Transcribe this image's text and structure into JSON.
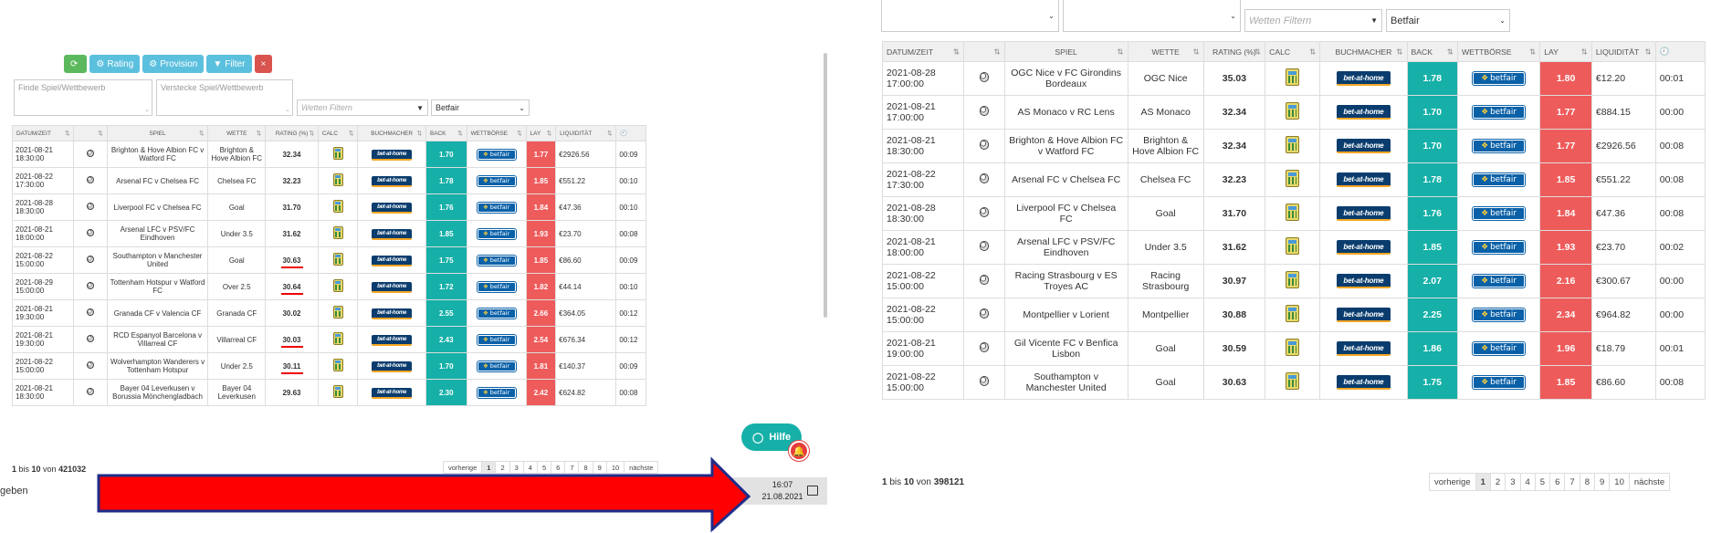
{
  "left": {
    "toolbar": {
      "refresh_label": "",
      "rating_label": "Rating",
      "provision_label": "Provision",
      "filter_label": "Filter",
      "close_label": "×"
    },
    "search_placeholder": "Finde Spiel/Wettbewerb",
    "hide_placeholder": "Verstecke Spiel/Wettbewerb",
    "bet_filter_placeholder": "Wetten Filtern",
    "exchange_value": "Betfair",
    "columns": [
      "DATUM/ZEIT",
      "",
      "SPIEL",
      "WETTE",
      "RATING (%)",
      "CALC",
      "BUCHMACHER",
      "BACK",
      "WETTBÖRSE",
      "LAY",
      "LIQUIDITÄT",
      ""
    ],
    "rows": [
      {
        "date": "2021-08-21",
        "time": "18:30:00",
        "game": "Brighton & Hove Albion FC v Watford FC",
        "bet": "Brighton & Hove Albion FC",
        "rating": "32.34",
        "back": "1.70",
        "lay": "1.77",
        "liq": "€2926.56",
        "t": "00:09"
      },
      {
        "date": "2021-08-22",
        "time": "17:30:00",
        "game": "Arsenal FC v Chelsea FC",
        "bet": "Chelsea FC",
        "rating": "32.23",
        "back": "1.78",
        "lay": "1.85",
        "liq": "€551.22",
        "t": "00:10"
      },
      {
        "date": "2021-08-28",
        "time": "18:30:00",
        "game": "Liverpool FC v Chelsea FC",
        "bet": "Goal",
        "rating": "31.70",
        "back": "1.76",
        "lay": "1.84",
        "liq": "€47.36",
        "t": "00:10"
      },
      {
        "date": "2021-08-21",
        "time": "18:00:00",
        "game": "Arsenal LFC v PSV/FC Eindhoven",
        "bet": "Under 3.5",
        "rating": "31.62",
        "back": "1.85",
        "lay": "1.93",
        "liq": "€23.70",
        "t": "00:08"
      },
      {
        "date": "2021-08-22",
        "time": "15:00:00",
        "game": "Southampton v Manchester United",
        "bet": "Goal",
        "rating": "30.63",
        "back": "1.75",
        "lay": "1.85",
        "liq": "€86.60",
        "t": "00:09"
      },
      {
        "date": "2021-08-29",
        "time": "15:00:00",
        "game": "Tottenham Hotspur v Watford FC",
        "bet": "Over 2.5",
        "rating": "30.64",
        "back": "1.72",
        "lay": "1.82",
        "liq": "€44.14",
        "t": "00:10"
      },
      {
        "date": "2021-08-21",
        "time": "19:30:00",
        "game": "Granada CF v Valencia CF",
        "bet": "Granada CF",
        "rating": "30.02",
        "back": "2.55",
        "lay": "2.66",
        "liq": "€364.05",
        "t": "00:12"
      },
      {
        "date": "2021-08-21",
        "time": "19:30:00",
        "game": "RCD Espanyol Barcelona v Villarreal CF",
        "bet": "Villarreal CF",
        "rating": "30.03",
        "back": "2.43",
        "lay": "2.54",
        "liq": "€676.34",
        "t": "00:12"
      },
      {
        "date": "2021-08-22",
        "time": "15:00:00",
        "game": "Wolverhampton Wanderers v Tottenham Hotspur",
        "bet": "Under 2.5",
        "rating": "30.11",
        "back": "1.70",
        "lay": "1.81",
        "liq": "€140.37",
        "t": "00:09"
      },
      {
        "date": "2021-08-21",
        "time": "18:30:00",
        "game": "Bayer 04 Leverkusen v Borussia Mönchengladbach",
        "bet": "Bayer 04 Leverkusen",
        "rating": "29.63",
        "back": "2.30",
        "lay": "2.42",
        "liq": "€624.82",
        "t": "00:08"
      }
    ],
    "footer": {
      "a": "1",
      "b": " bis ",
      "c": "10",
      "d": " von ",
      "e": "421032"
    },
    "pager": [
      "vorherige",
      "1",
      "2",
      "3",
      "4",
      "5",
      "6",
      "7",
      "8",
      "9",
      "10",
      "nächste"
    ],
    "hilfe_label": "Hilfe",
    "clock_time": "16:07",
    "clock_date": "21.08.2021",
    "geben_text": "geben"
  },
  "right": {
    "bet_filter_placeholder": "Wetten Filtern",
    "exchange_value": "Betfair",
    "columns": [
      "DATUM/ZEIT",
      "",
      "SPIEL",
      "WETTE",
      "RATING (%)",
      "CALC",
      "BUCHMACHER",
      "BACK",
      "WETTBÖRSE",
      "LAY",
      "LIQUIDITÄT",
      ""
    ],
    "rows": [
      {
        "date": "2021-08-28",
        "time": "17:00:00",
        "game": "OGC Nice v FC Girondins Bordeaux",
        "bet": "OGC Nice",
        "rating": "35.03",
        "back": "1.78",
        "lay": "1.80",
        "liq": "€12.20",
        "t": "00:01"
      },
      {
        "date": "2021-08-21",
        "time": "17:00:00",
        "game": "AS Monaco v RC Lens",
        "bet": "AS Monaco",
        "rating": "32.34",
        "back": "1.70",
        "lay": "1.77",
        "liq": "€884.15",
        "t": "00:00"
      },
      {
        "date": "2021-08-21",
        "time": "18:30:00",
        "game": "Brighton & Hove Albion FC v Watford FC",
        "bet": "Brighton & Hove Albion FC",
        "rating": "32.34",
        "back": "1.70",
        "lay": "1.77",
        "liq": "€2926.56",
        "t": "00:08"
      },
      {
        "date": "2021-08-22",
        "time": "17:30:00",
        "game": "Arsenal FC v Chelsea FC",
        "bet": "Chelsea FC",
        "rating": "32.23",
        "back": "1.78",
        "lay": "1.85",
        "liq": "€551.22",
        "t": "00:08"
      },
      {
        "date": "2021-08-28",
        "time": "18:30:00",
        "game": "Liverpool FC v Chelsea FC",
        "bet": "Goal",
        "rating": "31.70",
        "back": "1.76",
        "lay": "1.84",
        "liq": "€47.36",
        "t": "00:08"
      },
      {
        "date": "2021-08-21",
        "time": "18:00:00",
        "game": "Arsenal LFC v PSV/FC Eindhoven",
        "bet": "Under 3.5",
        "rating": "31.62",
        "back": "1.85",
        "lay": "1.93",
        "liq": "€23.70",
        "t": "00:02"
      },
      {
        "date": "2021-08-22",
        "time": "15:00:00",
        "game": "Racing Strasbourg v ES Troyes AC",
        "bet": "Racing Strasbourg",
        "rating": "30.97",
        "back": "2.07",
        "lay": "2.16",
        "liq": "€300.67",
        "t": "00:00"
      },
      {
        "date": "2021-08-22",
        "time": "15:00:00",
        "game": "Montpellier v Lorient",
        "bet": "Montpellier",
        "rating": "30.88",
        "back": "2.25",
        "lay": "2.34",
        "liq": "€964.82",
        "t": "00:00"
      },
      {
        "date": "2021-08-21",
        "time": "19:00:00",
        "game": "Gil Vicente FC v Benfica Lisbon",
        "bet": "Goal",
        "rating": "30.59",
        "back": "1.86",
        "lay": "1.96",
        "liq": "€18.79",
        "t": "00:01"
      },
      {
        "date": "2021-08-22",
        "time": "15:00:00",
        "game": "Southampton v Manchester United",
        "bet": "Goal",
        "rating": "30.63",
        "back": "1.75",
        "lay": "1.85",
        "liq": "€86.60",
        "t": "00:08"
      }
    ],
    "footer": {
      "a": "1",
      "b": " bis ",
      "c": "10",
      "d": " von ",
      "e": "398121"
    },
    "pager": [
      "vorherige",
      "1",
      "2",
      "3",
      "4",
      "5",
      "6",
      "7",
      "8",
      "9",
      "10",
      "nächste"
    ]
  },
  "logos": {
    "bookmaker": "bet-at-home",
    "exchange": "betfair"
  },
  "colors": {
    "back": "#16b0a8",
    "lay": "#ee5b5b",
    "arrow": "#ff0000",
    "arrow_outline": "#1f2d8a",
    "underline": "#e00000"
  },
  "underlined_rows_left": [
    4,
    5,
    7,
    8
  ]
}
